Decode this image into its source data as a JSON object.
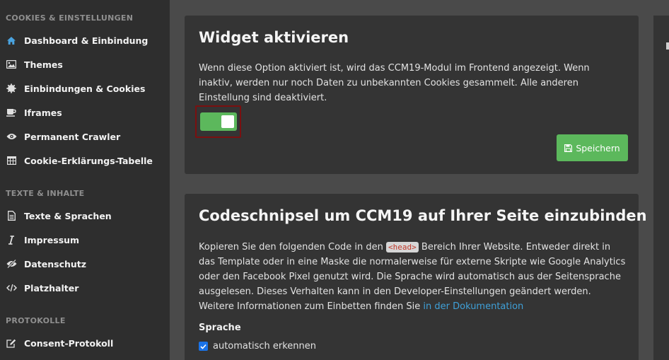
{
  "sidebar": {
    "sections": [
      {
        "title": "COOKIES & EINSTELLUNGEN",
        "items": [
          {
            "label": "Dashboard & Einbindung",
            "icon": "home-icon",
            "active": true
          },
          {
            "label": "Themes",
            "icon": "image-icon"
          },
          {
            "label": "Einbindungen & Cookies",
            "icon": "cookie-icon"
          },
          {
            "label": "Iframes",
            "icon": "coffee-icon"
          },
          {
            "label": "Permanent Crawler",
            "icon": "eye-icon"
          },
          {
            "label": "Cookie-Erklärungs-Tabelle",
            "icon": "table-icon"
          }
        ]
      },
      {
        "title": "TEXTE & INHALTE",
        "items": [
          {
            "label": "Texte & Sprachen",
            "icon": "document-icon"
          },
          {
            "label": "Impressum",
            "icon": "italic-icon"
          },
          {
            "label": "Datenschutz",
            "icon": "eye-slash-icon"
          },
          {
            "label": "Platzhalter",
            "icon": "code-icon"
          }
        ]
      },
      {
        "title": "PROTOKOLLE",
        "items": [
          {
            "label": "Consent-Protokoll",
            "icon": "edit-icon"
          }
        ]
      }
    ]
  },
  "widget_card": {
    "title": "Widget aktivieren",
    "description": "Wenn diese Option aktiviert ist, wird das CCM19-Modul im Frontend angezeigt. Wenn inaktiv, werden nur noch Daten zu unbekannten Cookies gesammelt. Alle anderen Einstellung sind deaktiviert.",
    "toggle_on": true,
    "save_label": "Speichern"
  },
  "code_card": {
    "title": "Codeschnipsel um CCM19 auf Ihrer Seite einzubinden",
    "text_before": "Kopieren Sie den folgenden Code in den ",
    "code_tag": "<head>",
    "text_after": " Bereich Ihrer Website. Entweder direkt in das Template oder in eine Maske die normalerweise für externe Skripte wie Google Analytics oder den Facebook Pixel genutzt wird. Die Sprache wird automatisch aus der Seitensprache ausgelesen. Dieses Verhalten kann in den Developer-Einstellungen geändert werden. Weitere Informationen zum Einbetten finden Sie ",
    "doc_link": "in der Dokumentation",
    "language_label": "Sprache",
    "auto_detect_label": "automatisch erkennen",
    "auto_detect_checked": true
  },
  "colors": {
    "accent_green": "#5cb85c",
    "link_blue": "#3fa0d8",
    "active_icon": "#4aa3df"
  }
}
